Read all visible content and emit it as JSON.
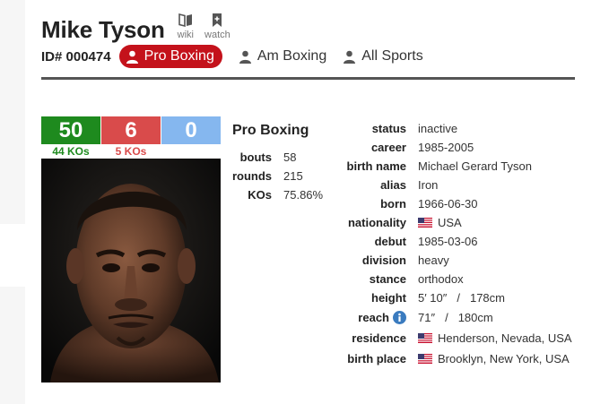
{
  "header": {
    "name": "Mike Tyson",
    "id_label": "ID# 000474",
    "tools": [
      {
        "label": "wiki",
        "icon": "book-icon"
      },
      {
        "label": "watch",
        "icon": "bookmark-icon"
      }
    ],
    "tabs": {
      "active": {
        "label": "Pro Boxing",
        "icon": "person-icon"
      },
      "am": {
        "label": "Am Boxing",
        "icon": "person-icon"
      },
      "all": {
        "label": "All Sports",
        "icon": "person-icon"
      }
    }
  },
  "record": {
    "wins": "50",
    "losses": "6",
    "draws": "0",
    "wins_kos": "44 KOs",
    "losses_kos": "5 KOs"
  },
  "stats": {
    "title": "Pro Boxing",
    "rows": [
      {
        "key": "bouts",
        "value": "58"
      },
      {
        "key": "rounds",
        "value": "215"
      },
      {
        "key": "KOs",
        "value": "75.86%"
      }
    ]
  },
  "info": {
    "status": {
      "key": "status",
      "value": "inactive"
    },
    "career": {
      "key": "career",
      "value": "1985-2005"
    },
    "birth_name": {
      "key": "birth name",
      "value": "Michael Gerard Tyson"
    },
    "alias": {
      "key": "alias",
      "value": "Iron"
    },
    "born": {
      "key": "born",
      "value": "1966-06-30"
    },
    "nationality": {
      "key": "nationality",
      "value": "USA"
    },
    "debut": {
      "key": "debut",
      "value": "1985-03-06"
    },
    "division": {
      "key": "division",
      "value": "heavy"
    },
    "stance": {
      "key": "stance",
      "value": "orthodox"
    },
    "height": {
      "key": "height",
      "imperial": "5′ 10″",
      "sep": "/",
      "metric": "178cm"
    },
    "reach": {
      "key": "reach",
      "imperial": "71″",
      "sep": "/",
      "metric": "180cm"
    },
    "residence": {
      "key": "residence",
      "value": "Henderson, Nevada, USA"
    },
    "birth_place": {
      "key": "birth place",
      "value": "Brooklyn, New York, USA"
    }
  },
  "colors": {
    "win": "#1e8a1e",
    "loss": "#d94b4b",
    "draw": "#85b7ef",
    "active_tab": "#c4121b"
  }
}
